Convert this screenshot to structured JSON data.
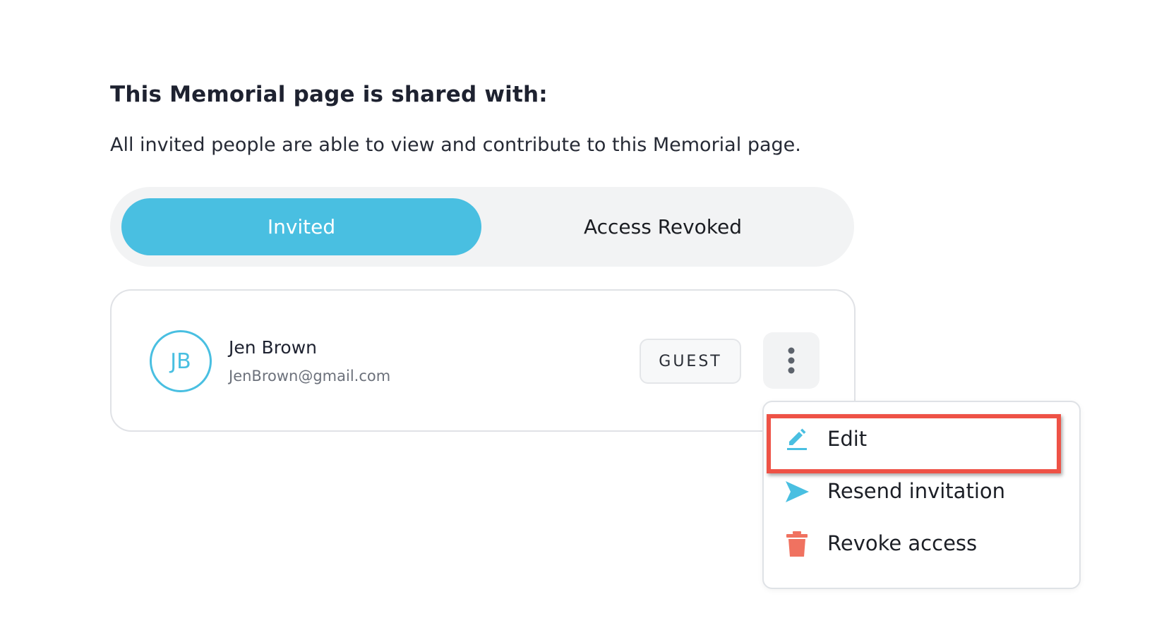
{
  "section": {
    "title": "This Memorial page is shared with:",
    "description": "All invited people are able to view and contribute to this Memorial page."
  },
  "tabs": [
    {
      "label": "Invited",
      "active": true
    },
    {
      "label": "Access Revoked",
      "active": false
    }
  ],
  "member": {
    "initials": "JB",
    "name": "Jen Brown",
    "email": "JenBrown@gmail.com",
    "role": "GUEST"
  },
  "menu": {
    "items": [
      {
        "label": "Edit",
        "icon": "pencil-icon",
        "highlighted": true
      },
      {
        "label": "Resend invitation",
        "icon": "send-icon"
      },
      {
        "label": "Revoke access",
        "icon": "trash-icon"
      }
    ]
  },
  "colors": {
    "accent": "#49bfe1",
    "danger": "#f07260",
    "highlight": "#ee5246"
  }
}
